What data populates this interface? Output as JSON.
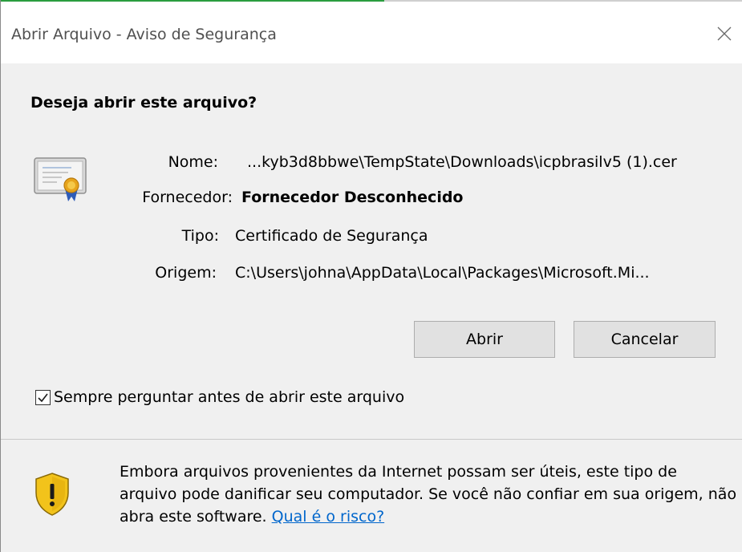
{
  "dialog": {
    "title": "Abrir Arquivo - Aviso de Segurança",
    "close_symbol": "×",
    "question": "Deseja abrir este arquivo?",
    "fields": {
      "name_label": "Nome:",
      "name_value": "...kyb3d8bbwe\\TempState\\Downloads\\icpbrasilv5 (1).cer",
      "publisher_label": "Fornecedor:",
      "publisher_value": "Fornecedor Desconhecido",
      "type_label": "Tipo:",
      "type_value": "Certificado de Segurança",
      "origin_label": "Origem:",
      "origin_value": "C:\\Users\\johna\\AppData\\Local\\Packages\\Microsoft.Mi..."
    },
    "buttons": {
      "open_label": "Abrir",
      "cancel_label": "Cancelar"
    },
    "checkbox": {
      "label": "Sempre perguntar antes de abrir este arquivo",
      "checked": true
    },
    "warning": {
      "text": "Embora arquivos provenientes da Internet possam ser úteis, este tipo de arquivo pode danificar seu computador. Se você não confiar em sua origem, não abra este software.",
      "link_label": "Qual é o risco?"
    },
    "icons": {
      "certificate": "certificate-icon",
      "shield": "security-shield-warning-icon",
      "close": "close-icon",
      "check": "checkmark-icon"
    },
    "colors": {
      "accent_green": "#2a9d3f",
      "link": "#0066cc",
      "shield_yellow": "#f2c31b"
    }
  }
}
